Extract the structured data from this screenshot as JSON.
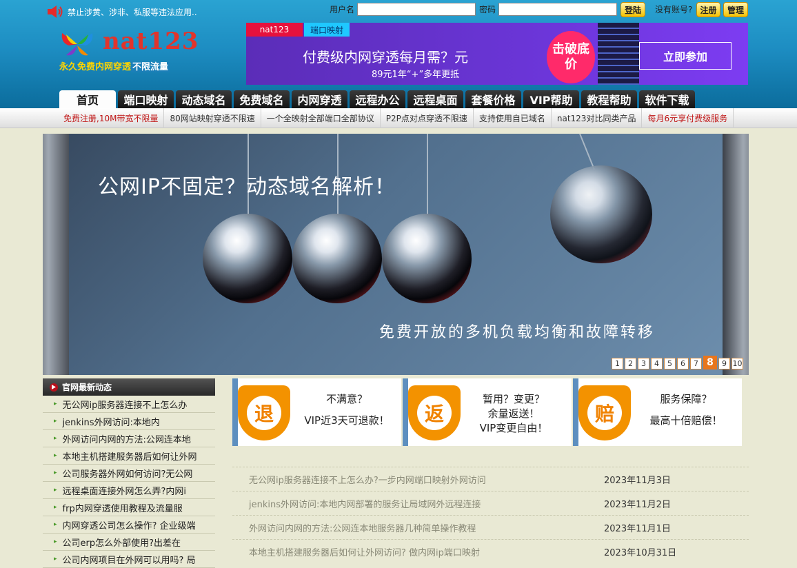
{
  "notice": {
    "text": "禁止涉黄、涉非、私服等违法应用.."
  },
  "login": {
    "username_label": "用户名",
    "password_label": "密码",
    "login_button": "登陆",
    "no_account_text": "没有账号?",
    "register_button": "注册",
    "manage_button": "管理"
  },
  "logo": {
    "text": "nat123",
    "slogan_part1": "永久免费内网穿透",
    "slogan_part2": "不限流量"
  },
  "banner": {
    "tag_left": "nat123",
    "tag_right": "端口映射",
    "headline": "付费级内网穿透每月需？元",
    "subline": "89元1年“+”多年更抵",
    "seal": "击破底价",
    "cta": "立即参加"
  },
  "nav": {
    "tabs": [
      "首页",
      "端口映射",
      "动态域名",
      "免费域名",
      "内网穿透",
      "远程办公",
      "远程桌面",
      "套餐价格",
      "VIP帮助",
      "教程帮助",
      "软件下载"
    ],
    "active_index": 0
  },
  "subnav": [
    {
      "label": "免费注册,10M带宽不限量",
      "highlight": true
    },
    {
      "label": "80网站映射穿透不限速",
      "highlight": false
    },
    {
      "label": "一个全映射全部端口全部协议",
      "highlight": false
    },
    {
      "label": "P2P点对点穿透不限速",
      "highlight": false
    },
    {
      "label": "支持使用自已域名",
      "highlight": false
    },
    {
      "label": "nat123对比同类产品",
      "highlight": false
    },
    {
      "label": "每月6元享付费级服务",
      "highlight": true
    }
  ],
  "slideshow": {
    "headline": "公网IP不固定？动态域名解析！",
    "subline": "免费开放的多机负载均衡和故障转移",
    "pages": [
      "1",
      "2",
      "3",
      "4",
      "5",
      "6",
      "7",
      "8",
      "9",
      "10"
    ],
    "current_page": "8"
  },
  "news_panel": {
    "title": "官网最新动态",
    "items": [
      "无公网ip服务器连接不上怎么办",
      "jenkins外网访问:本地内",
      "外网访问内网的方法:公网连本地",
      "本地主机搭建服务器后如何让外网",
      "公司服务器外网如何访问?无公网",
      "远程桌面连接外网怎么弄?内网i",
      "frp内网穿透使用教程及流量服",
      "内网穿透公司怎么操作? 企业级端",
      "公司erp怎么外部使用?出差在",
      "公司内网项目在外网可以用吗? 局"
    ]
  },
  "cards": [
    {
      "badge": "退",
      "line1": "不满意？",
      "line2": "VIP近3天可退款！",
      "line3": ""
    },
    {
      "badge": "返",
      "line1": "暂用？变更？",
      "line2": "余量返送！",
      "line3": "VIP变更自由！"
    },
    {
      "badge": "赔",
      "line1": "服务保障？",
      "line2": "最高十倍赔偿！",
      "line3": ""
    }
  ],
  "article_list": [
    {
      "title": "无公网ip服务器连接不上怎么办?一步内网端口映射外网访问",
      "date": "2023年11月3日"
    },
    {
      "title": "jenkins外网访问:本地内网部署的服务让局域网外远程连接",
      "date": "2023年11月2日"
    },
    {
      "title": "外网访问内网的方法:公网连本地服务器几种简单操作教程",
      "date": "2023年11月1日"
    },
    {
      "title": "本地主机搭建服务器后如何让外网访问? 做内网ip端口映射",
      "date": "2023年10月31日"
    }
  ]
}
